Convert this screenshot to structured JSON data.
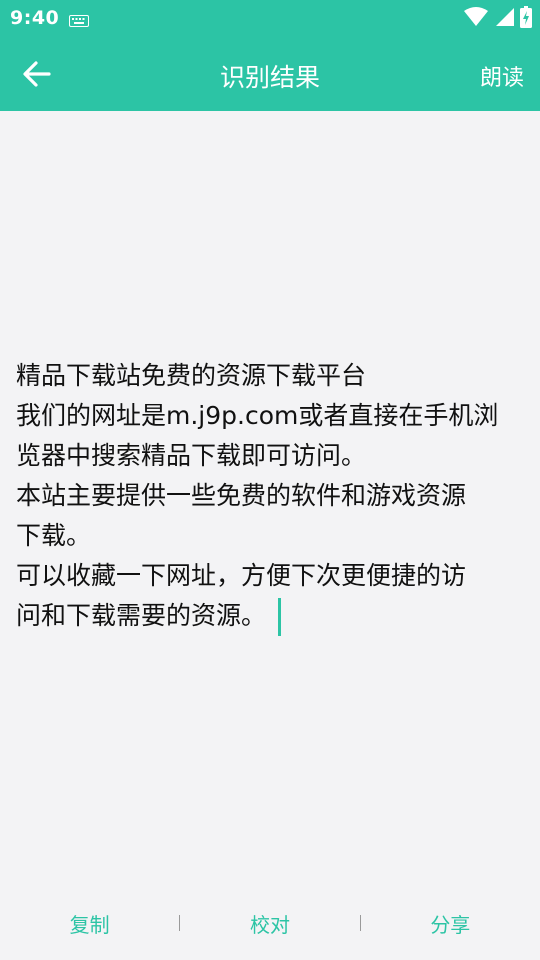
{
  "status_bar": {
    "time": "9:40",
    "icons": [
      "keyboard-icon",
      "wifi-icon",
      "signal-icon",
      "battery-icon"
    ]
  },
  "app_bar": {
    "title": "识别结果",
    "back_icon": "arrow-left-icon",
    "read_label": "朗读"
  },
  "content": {
    "lines": [
      "精品下载站免费的资源下载平台",
      "我们的网址是m.j9p.com或者直接在手机浏",
      "览器中搜索精品下载即可访问。",
      "本站主要提供一些免费的软件和游戏资源",
      "下载。",
      "可以收藏一下网址，方便下次更便捷的访",
      "问和下载需要的资源。"
    ]
  },
  "bottom_bar": {
    "copy_label": "复制",
    "proofread_label": "校对",
    "share_label": "分享"
  },
  "colors": {
    "accent": "#2cc4a5",
    "background": "#f3f3f5",
    "text": "#111111"
  }
}
